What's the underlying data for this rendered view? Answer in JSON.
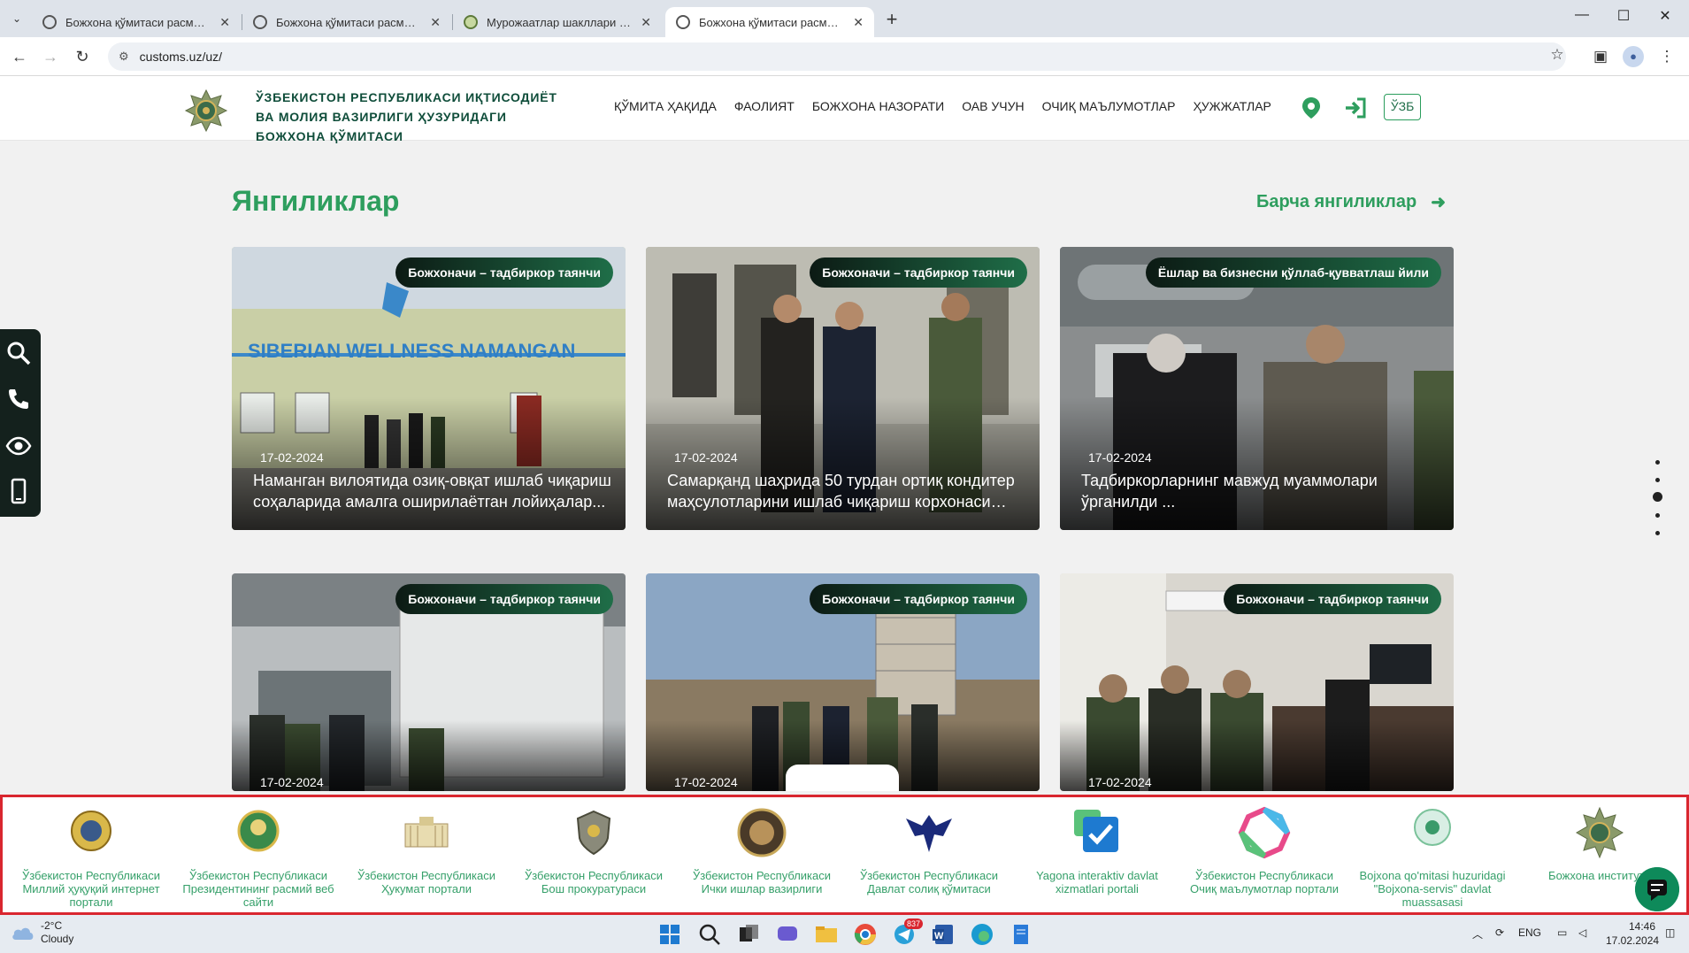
{
  "browser": {
    "tabs": [
      {
        "title": "Божхона қўмитаси расмий веб",
        "active": false
      },
      {
        "title": "Божхона қўмитаси расмий веб",
        "active": false
      },
      {
        "title": "Мурожаатлар шакллари ва ул",
        "active": false
      },
      {
        "title": "Божхона қўмитаси расмий веб",
        "active": true
      }
    ],
    "url": "customs.uz/uz/"
  },
  "header": {
    "org_name": "Ўзбекистон Республикаси иқтисодиёт ва молия вазирлиги ҳузуридаги божхона қўмитаси",
    "nav": [
      "ҚЎМИТА ҲАҚИДА",
      "ФАОЛИЯТ",
      "БОЖХОНА НАЗОРАТИ",
      "ОАВ УЧУН",
      "ОЧИҚ МАЪЛУМОТЛАР",
      "ҲУЖЖАТЛАР"
    ],
    "lang": "ЎЗБ"
  },
  "news": {
    "heading": "Янгиликлар",
    "all_link": "Барча янгиликлар",
    "cards": [
      {
        "tag": "Божхоначи – тадбиркор таянчи",
        "date": "17-02-2024",
        "title": "Наманган вилоятида озиқ-овқат ишлаб чиқариш соҳаларида амалга оширилаётган лойиҳалар..."
      },
      {
        "tag": "Божхоначи – тадбиркор таянчи",
        "date": "17-02-2024",
        "title": "Самарқанд шаҳрида 50 турдан ортиқ кондитер маҳсулотларини ишлаб чиқариш корхонаси ишг..."
      },
      {
        "tag": "Ёшлар ва бизнесни қўллаб-қувватлаш йили",
        "date": "17-02-2024",
        "title": "Тадбиркорларнинг мавжуд муаммолари ўрганилди ..."
      },
      {
        "tag": "Божхоначи – тадбиркор таянчи",
        "date": "17-02-2024",
        "title": ""
      },
      {
        "tag": "Божхоначи – тадбиркор таянчи",
        "date": "17-02-2024",
        "title": ""
      },
      {
        "tag": "Божхоначи – тадбиркор таянчи",
        "date": "17-02-2024",
        "title": ""
      }
    ]
  },
  "partners": [
    {
      "label": "Ўзбекистон Республикаси Миллий ҳуқуқий интернет портали"
    },
    {
      "label": "Ўзбекистон Республикаси Президентининг расмий веб сайти"
    },
    {
      "label": "Ўзбекистон Республикаси Ҳукумат портали"
    },
    {
      "label": "Ўзбекистон Республикаси Бош прокуратураси"
    },
    {
      "label": "Ўзбекистон Республикаси Ички ишлар вазирлиги"
    },
    {
      "label": "Ўзбекистон Республикаси Давлат солиқ қўмитаси"
    },
    {
      "label": "Yagona interaktiv davlat xizmatlari portali"
    },
    {
      "label": "Ўзбекистон Республикаси Очиқ маълумотлар портали"
    },
    {
      "label": "Bojxona qo'mitasi huzuridagi \"Bojxona-servis\" davlat muassasasi"
    },
    {
      "label": "Божхона институти"
    }
  ],
  "taskbar": {
    "temperature": "-2°C",
    "weather": "Cloudy",
    "lang": "ENG",
    "time": "14:46",
    "date": "17.02.2024",
    "telegram_badge": "837"
  },
  "colors": {
    "brand_green": "#2e9e5e",
    "dark_green": "#0f4d3a",
    "highlight_border": "#d9262f"
  }
}
